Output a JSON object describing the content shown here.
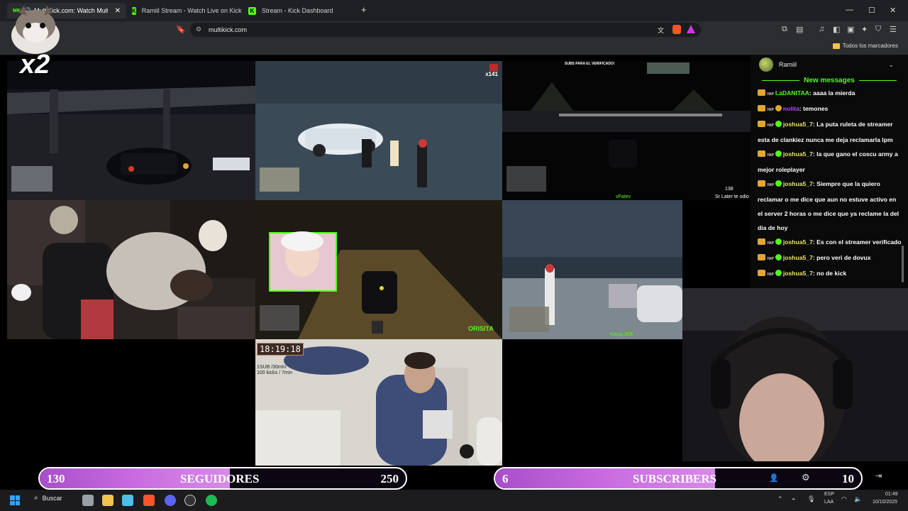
{
  "browser": {
    "tabs": [
      {
        "label": "MultiKick.com: Watch Multip",
        "active": true
      },
      {
        "label": "Ramiil Stream - Watch Live on Kick",
        "active": false
      },
      {
        "label": "Stream - Kick Dashboard",
        "active": false
      }
    ],
    "new_tab_icon": "plus-icon",
    "url": "multikick.com",
    "bookmarks_folder": "Todos los marcadores"
  },
  "overlay": {
    "multiplier": "x2",
    "counter_badge": "x141"
  },
  "streams": {
    "top_middle": {
      "corner_count": "x141"
    },
    "top_right": {
      "banner": "SUBS PARA EL VERIFICADO!",
      "tag": "vFatev",
      "corner": "Sr Later te odio",
      "num": "138"
    },
    "middle_middle": {
      "tag": "ORISITA",
      "cam_tag": "ORISITA"
    },
    "middle_right": {
      "tag": "Katya.JDE"
    },
    "bottom_middle": {
      "timer": "18:19:18",
      "line1": "1SUB /30min",
      "line2": "100 kicks / 7min"
    }
  },
  "chat": {
    "streamer": "Ramiil",
    "new_messages_label": "New messages",
    "messages": [
      {
        "user": "LaDANITAA",
        "text": "aaaa la mierda",
        "color": "green",
        "verified": false,
        "warn": false
      },
      {
        "user": "nolita",
        "text": "temones",
        "color": "purple",
        "verified": false,
        "warn": true
      },
      {
        "user": "joshua5_7",
        "text": "La puta ruleta de streamer esta de clankiez nunca me deja reclamarla lpm",
        "color": "gold",
        "verified": true,
        "warn": false
      },
      {
        "user": "joshua5_7",
        "text": "la que gano el coscu army a mejor roleplayer",
        "color": "gold",
        "verified": true,
        "warn": false
      },
      {
        "user": "joshua5_7",
        "text": "Siempre que la quiero reclamar o me dice que aun no estuve activo en el server 2 horas o me dice que ya reclame la del dia de hoy",
        "color": "gold",
        "verified": true,
        "warn": false
      },
      {
        "user": "joshua5_7",
        "text": "Es con el streamer verificado",
        "color": "gold",
        "verified": true,
        "warn": false
      },
      {
        "user": "joshua5_7",
        "text": "pero veri de dovux",
        "color": "gold",
        "verified": true,
        "warn": false
      },
      {
        "user": "joshua5_7",
        "text": "no de kick",
        "color": "gold",
        "verified": true,
        "warn": false
      }
    ]
  },
  "goals": {
    "followers": {
      "current": "130",
      "label": "SEGUIDORES",
      "target": "250",
      "progress": 0.52
    },
    "subs": {
      "current": "6",
      "label": "SUBSCRIBERS",
      "target": "10",
      "progress": 0.6
    }
  },
  "taskbar": {
    "search_label": "Buscar",
    "lang1": "ESP",
    "lang2": "LAA",
    "time": "01:49",
    "date": "10/10/2025"
  },
  "colors": {
    "kick_green": "#53fc18",
    "goal_purple": "#c96be0"
  }
}
